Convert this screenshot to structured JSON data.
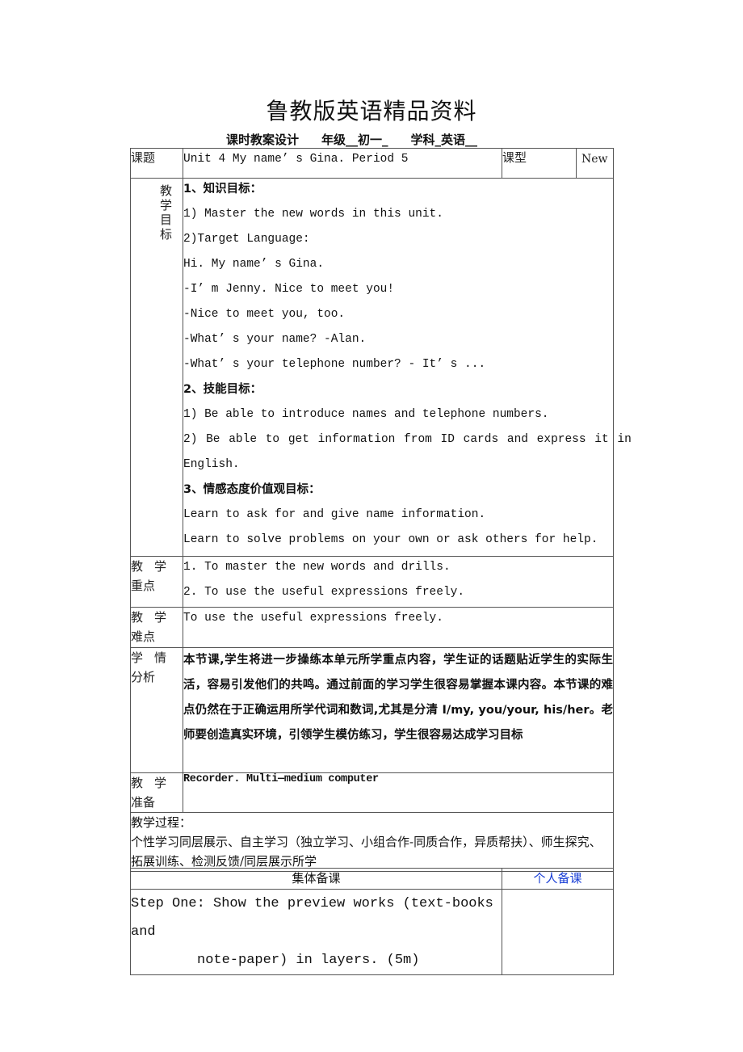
{
  "document": {
    "title": "鲁教版英语精品资料",
    "subtitle": {
      "design": "课时教案设计",
      "grade": "年级__初一_",
      "subject": "学科_英语__"
    }
  },
  "header_row": {
    "topic_label": "课题",
    "topic_value": "Unit 4 My name’ s Gina. Period 5",
    "type_label": "课型",
    "type_value": "New"
  },
  "objectives": {
    "label": "教学目标",
    "lines": [
      "1、知识目标：",
      "1) Master the new words in this unit.",
      "2)Target Language:",
      "Hi. My name’ s Gina.",
      "-I’ m Jenny. Nice to meet you!",
      "-Nice to meet you, too.",
      "-What’ s your name? -Alan.",
      "-What’ s your telephone number? - It’ s ...",
      "2、技能目标：",
      "1) Be able to introduce names and telephone numbers.",
      "2) Be able to get information from ID cards and express it in",
      "English.",
      "3、情感态度价值观目标：",
      "Learn to ask for and give name information.",
      "Learn to solve problems on your own or ask others for help."
    ]
  },
  "key_points": {
    "label_top": [
      "教",
      "学"
    ],
    "label_bottom": [
      "重",
      "点"
    ],
    "lines": [
      "1. To master the new words and drills.",
      "2. To use the useful expressions freely."
    ]
  },
  "difficulties": {
    "label_top": [
      "教",
      "学"
    ],
    "label_bottom": [
      "难",
      "点"
    ],
    "text": "To use the useful expressions freely."
  },
  "analysis": {
    "label_top": [
      "学",
      "情"
    ],
    "label_bottom": [
      "分",
      "析"
    ],
    "text": "本节课,学生将进一步操练本单元所学重点内容，学生证的话题贴近学生的实际生活，容易引发他们的共鸣。通过前面的学习学生很容易掌握本课内容。本节课的难点仍然在于正确运用所学代词和数词,尤其是分清 I/my, you/your, his/her。老师要创造真实环境，引领学生模仿练习，学生很容易达成学习目标"
  },
  "preparation": {
    "label_top": [
      "教",
      "学"
    ],
    "label_bottom": [
      "准",
      "备"
    ],
    "text": "Recorder. Multi—medium computer"
  },
  "process": {
    "heading": "教学过程：",
    "text": "个性学习同层展示、自主学习（独立学习、小组合作-同质合作，异质帮扶）、师生探究、拓展训练、检测反馈/同层展示所学"
  },
  "prep_columns": {
    "collective": "集体备课",
    "personal": "个人备课"
  },
  "step_one": {
    "line1": "Step One: Show the preview works (text-books and",
    "line2": "note-paper) in layers. (5m)"
  }
}
